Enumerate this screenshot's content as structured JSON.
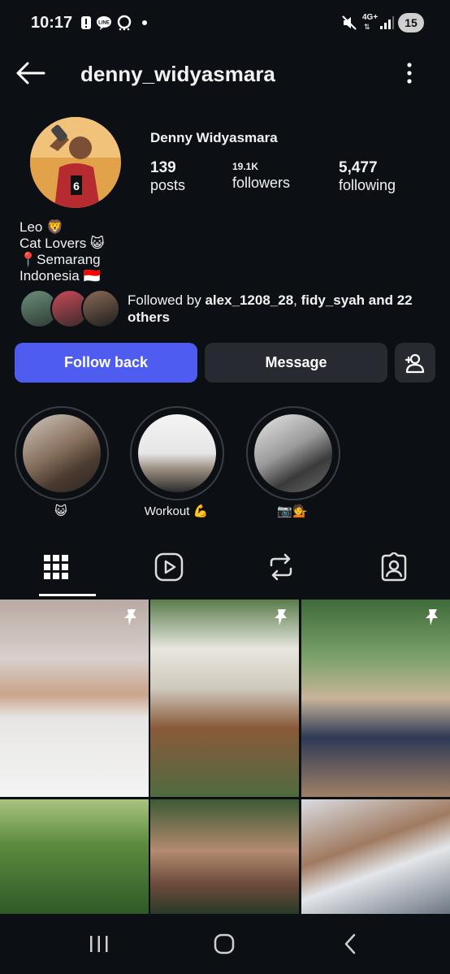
{
  "status_bar": {
    "time": "10:17",
    "network": "4G+",
    "battery": "15"
  },
  "header": {
    "username": "denny_widyasmara"
  },
  "profile": {
    "display_name": "Denny Widyasmara",
    "stats": [
      {
        "value": "139",
        "label": "posts"
      },
      {
        "value": "19.1K",
        "label": "followers"
      },
      {
        "value": "5,477",
        "label": "following"
      }
    ],
    "bio": [
      "Leo 🦁",
      "Cat Lovers 😺",
      "📍Semarang",
      "Indonesia 🇮🇩"
    ],
    "followed_by_prefix": "Followed by ",
    "followed_by_user1": "alex_1208_28",
    "followed_by_sep": ", ",
    "followed_by_user2": "fidy_syah",
    "followed_by_suffix": " and 22 others"
  },
  "actions": {
    "follow_back": "Follow back",
    "message": "Message"
  },
  "highlights": [
    {
      "label": "😺"
    },
    {
      "label": "Workout 💪"
    },
    {
      "label": "📷💁"
    }
  ],
  "tabs": [
    "grid-icon",
    "reels-icon",
    "reposts-icon",
    "tagged-icon"
  ],
  "colors": {
    "background": "#0c0f14",
    "accent": "#4e5cf0",
    "secondary_button": "#272a31"
  }
}
